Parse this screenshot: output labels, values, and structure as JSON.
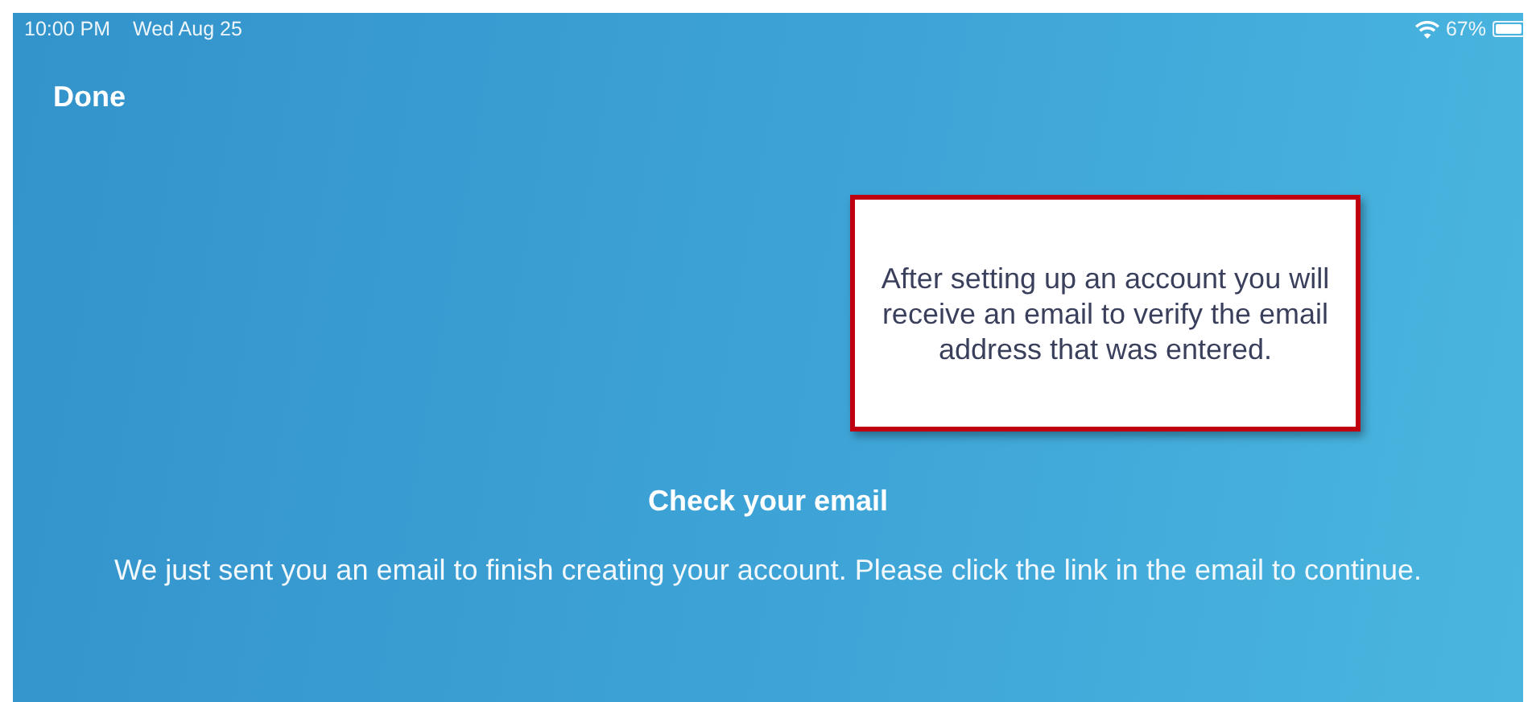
{
  "status_bar": {
    "time": "10:00 PM",
    "date": "Wed Aug 25",
    "battery": "67%"
  },
  "nav": {
    "done": "Done"
  },
  "callout": {
    "text": "After setting up an account you will receive an email to verify the email address that was entered."
  },
  "message": {
    "title": "Check your email",
    "body": "We just sent you an email to finish creating your account. Please click the link in the email to continue."
  }
}
